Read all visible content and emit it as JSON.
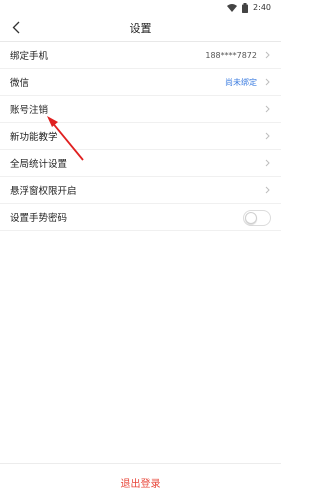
{
  "status_bar": {
    "time": "2:40"
  },
  "header": {
    "title": "设置"
  },
  "settings": {
    "items": [
      {
        "label": "绑定手机",
        "value": "188****7872"
      },
      {
        "label": "微信",
        "value": "尚未绑定"
      },
      {
        "label": "账号注销"
      },
      {
        "label": "新功能教学"
      },
      {
        "label": "全局统计设置"
      },
      {
        "label": "悬浮窗权限开启"
      },
      {
        "label": "设置手势密码",
        "toggle_on": false
      }
    ]
  },
  "footer": {
    "logout_label": "退出登录"
  },
  "colors": {
    "accent_blue": "#3a7be0",
    "logout_red": "#e8473a",
    "annotation_arrow": "#e02020"
  }
}
